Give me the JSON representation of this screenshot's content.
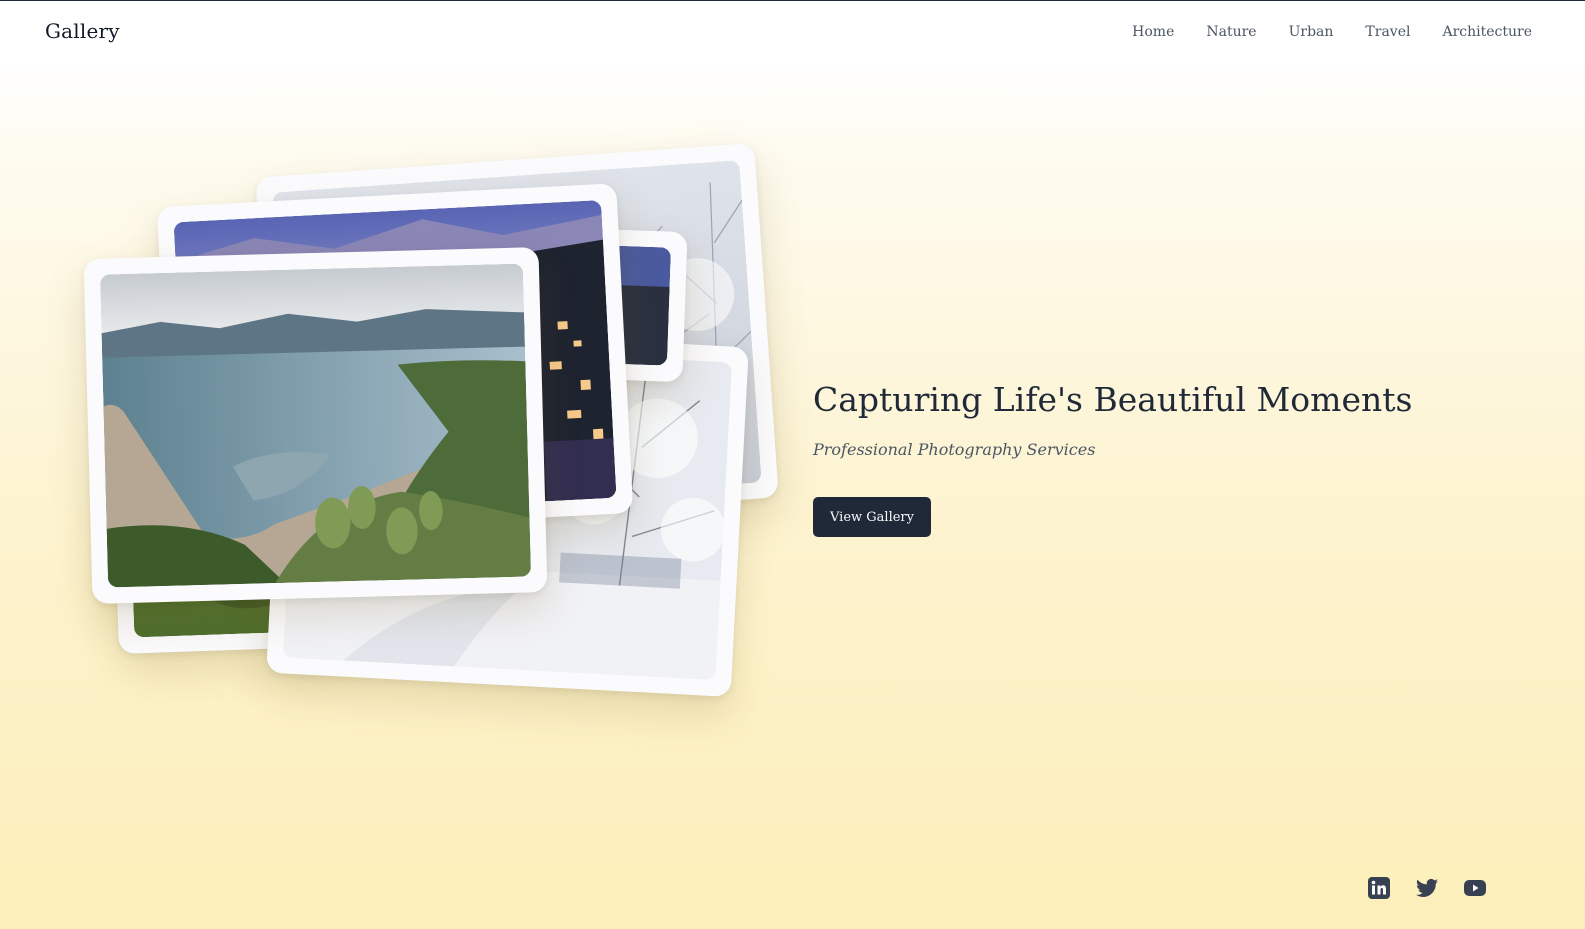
{
  "brand": {
    "logo_text": "Gallery"
  },
  "nav": {
    "items": [
      {
        "label": "Home"
      },
      {
        "label": "Nature"
      },
      {
        "label": "Urban"
      },
      {
        "label": "Travel"
      },
      {
        "label": "Architecture"
      }
    ]
  },
  "hero": {
    "title": "Capturing Life's Beautiful Moments",
    "subtitle": "Professional Photography Services",
    "cta_label": "View Gallery"
  },
  "photos": [
    {
      "subject": "snowy forest trees"
    },
    {
      "subject": "green landscape"
    },
    {
      "subject": "snowy forest path"
    },
    {
      "subject": "mountain town at dusk"
    },
    {
      "subject": "coastal lagoon sandbar"
    }
  ],
  "social": [
    {
      "icon": "linkedin-icon"
    },
    {
      "icon": "twitter-icon"
    },
    {
      "icon": "youtube-icon"
    }
  ],
  "colors": {
    "button_bg": "#1f2937",
    "icon_color": "#374151",
    "background_bottom": "#fcefba"
  }
}
